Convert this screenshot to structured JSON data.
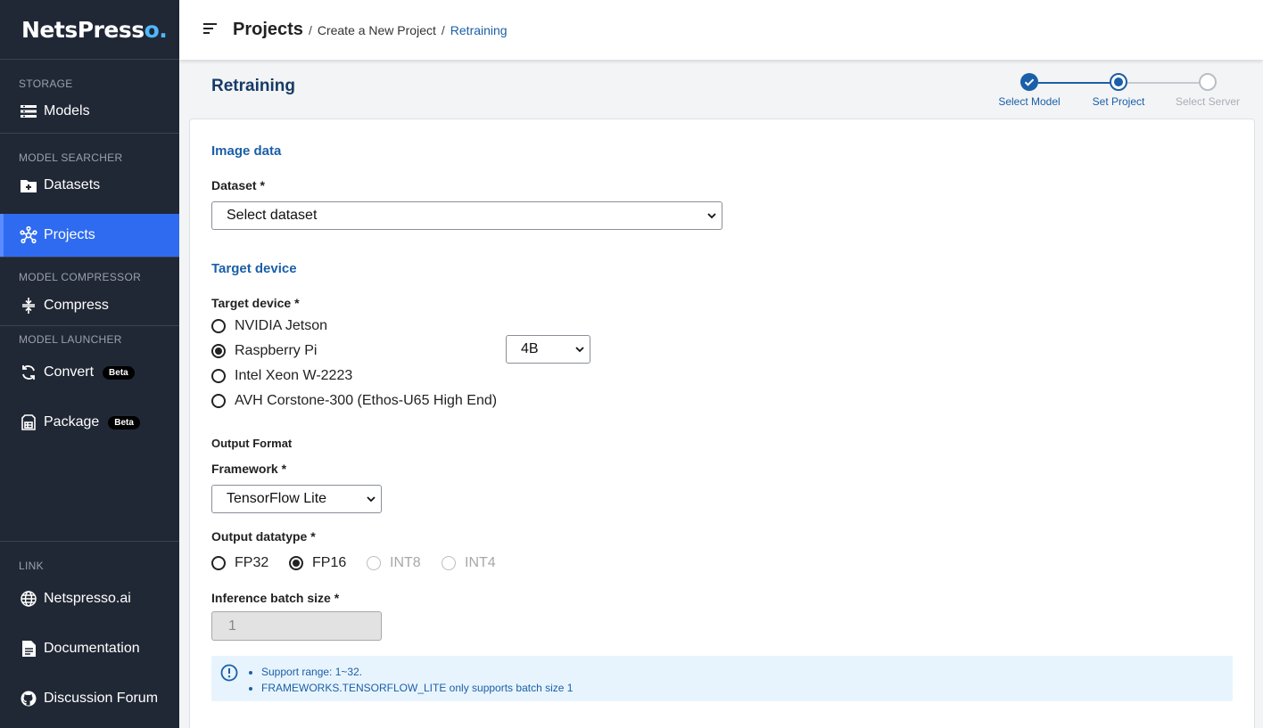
{
  "brand": {
    "name": "NetsPress",
    "suffix": "o."
  },
  "sidebar": {
    "sections": [
      {
        "label": "STORAGE",
        "items": [
          {
            "label": "Models",
            "icon": "list-icon"
          }
        ]
      },
      {
        "label": "MODEL SEARCHER",
        "items": [
          {
            "label": "Datasets",
            "icon": "folder-plus-icon"
          },
          {
            "label": "Projects",
            "icon": "network-icon",
            "active": true
          }
        ]
      },
      {
        "label": "MODEL COMPRESSOR",
        "items": [
          {
            "label": "Compress",
            "icon": "compress-icon"
          }
        ]
      },
      {
        "label": "MODEL LAUNCHER",
        "items": [
          {
            "label": "Convert",
            "icon": "sync-icon",
            "badge": "Beta"
          },
          {
            "label": "Package",
            "icon": "package-icon",
            "badge": "Beta"
          }
        ]
      }
    ],
    "link_section": {
      "label": "LINK",
      "items": [
        {
          "label": "Netspresso.ai",
          "icon": "globe-icon"
        },
        {
          "label": "Documentation",
          "icon": "document-icon"
        },
        {
          "label": "Discussion Forum",
          "icon": "github-icon"
        }
      ]
    }
  },
  "breadcrumb": {
    "root": "Projects",
    "middle": "Create a New Project",
    "current": "Retraining",
    "sep": "/"
  },
  "page": {
    "title": "Retraining"
  },
  "stepper": {
    "steps": [
      {
        "label": "Select Model",
        "state": "done"
      },
      {
        "label": "Set Project",
        "state": "current"
      },
      {
        "label": "Select Server",
        "state": "pending"
      }
    ],
    "colors": {
      "active": "#1a5fa8",
      "pending": "#b9bec6"
    }
  },
  "form": {
    "image_data": {
      "heading": "Image data",
      "dataset_label": "Dataset *",
      "dataset_value": "Select dataset"
    },
    "target": {
      "heading": "Target device",
      "label": "Target device *",
      "options": [
        "NVIDIA Jetson",
        "Raspberry Pi",
        "Intel Xeon W-2223",
        "AVH Corstone-300 (Ethos-U65 High End)"
      ],
      "selected": "Raspberry Pi",
      "version_value": "4B"
    },
    "output": {
      "heading": "Output Format",
      "framework_label": "Framework *",
      "framework_value": "TensorFlow Lite",
      "datatype_label": "Output datatype *",
      "datatypes": [
        {
          "label": "FP32",
          "checked": false,
          "disabled": false
        },
        {
          "label": "FP16",
          "checked": true,
          "disabled": false
        },
        {
          "label": "INT8",
          "checked": false,
          "disabled": true
        },
        {
          "label": "INT4",
          "checked": false,
          "disabled": true
        }
      ],
      "batch_label": "Inference batch size *",
      "batch_value": "1"
    },
    "info": {
      "lines": [
        "Support range: 1~32.",
        "FRAMEWORKS.TENSORFLOW_LITE only supports batch size 1"
      ],
      "icon": "info-circle-icon"
    }
  },
  "colors": {
    "sidebar_bg": "#212835",
    "active_item": "#2e6bf0",
    "accent": "#1a5fa8"
  }
}
